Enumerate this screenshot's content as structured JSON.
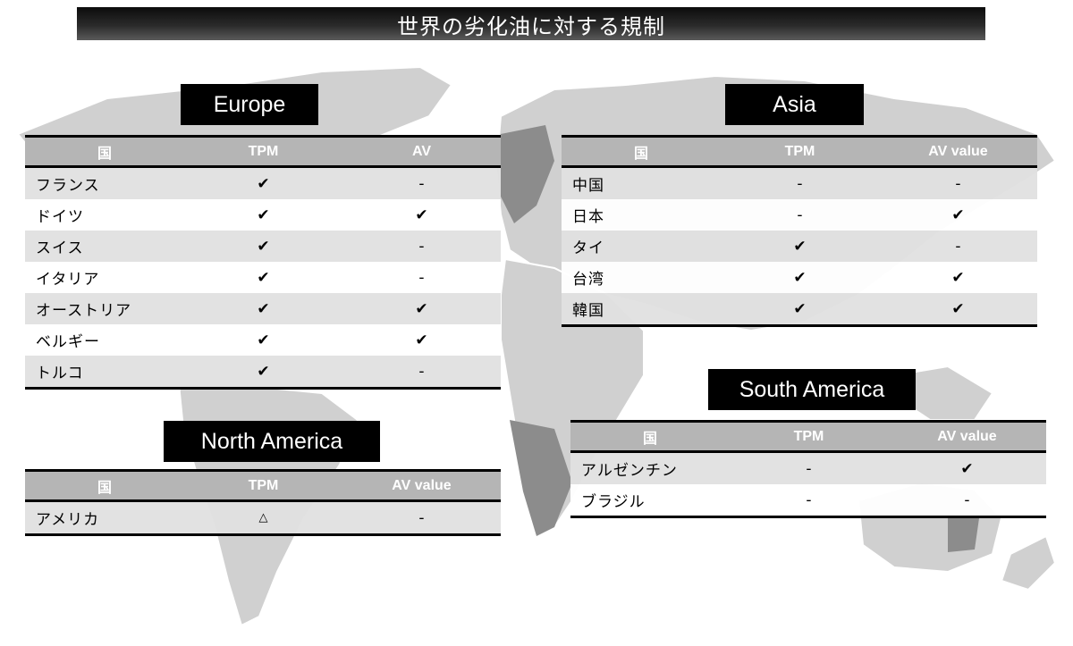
{
  "title": "世界の劣化油に対する規制",
  "europe": {
    "label": "Europe",
    "headers": [
      "国",
      "TPM",
      "AV"
    ],
    "rows": [
      {
        "country": "フランス",
        "tpm": "✔",
        "av": "-"
      },
      {
        "country": "ドイツ",
        "tpm": "✔",
        "av": "✔"
      },
      {
        "country": "スイス",
        "tpm": "✔",
        "av": "-"
      },
      {
        "country": "イタリア",
        "tpm": "✔",
        "av": "-"
      },
      {
        "country": "オーストリア",
        "tpm": "✔",
        "av": "✔"
      },
      {
        "country": "ベルギー",
        "tpm": "✔",
        "av": "✔"
      },
      {
        "country": "トルコ",
        "tpm": "✔",
        "av": "-"
      }
    ]
  },
  "asia": {
    "label": "Asia",
    "headers": [
      "国",
      "TPM",
      "AV value"
    ],
    "rows": [
      {
        "country": "中国",
        "tpm": "-",
        "av": "-"
      },
      {
        "country": "日本",
        "tpm": "-",
        "av": "✔"
      },
      {
        "country": "タイ",
        "tpm": "✔",
        "av": "-"
      },
      {
        "country": "台湾",
        "tpm": "✔",
        "av": "✔"
      },
      {
        "country": "韓国",
        "tpm": "✔",
        "av": "✔"
      }
    ],
    "muted_mark_color": "#aaaaaa"
  },
  "north_america": {
    "label": "North America",
    "headers": [
      "国",
      "TPM",
      "AV value"
    ],
    "rows": [
      {
        "country": "アメリカ",
        "tpm": "△",
        "av": "-"
      }
    ]
  },
  "south_america": {
    "label": "South America",
    "headers": [
      "国",
      "TPM",
      "AV value"
    ],
    "rows": [
      {
        "country": "アルゼンチン",
        "tpm": "-",
        "av": "✔"
      },
      {
        "country": "ブラジル",
        "tpm": "-",
        "av": "-"
      }
    ]
  },
  "colors": {
    "header_bg": "#b5b5b5",
    "label_bg": "#000000",
    "map_land": "#cfcfcf",
    "map_land_dark": "#8c8c8c"
  }
}
